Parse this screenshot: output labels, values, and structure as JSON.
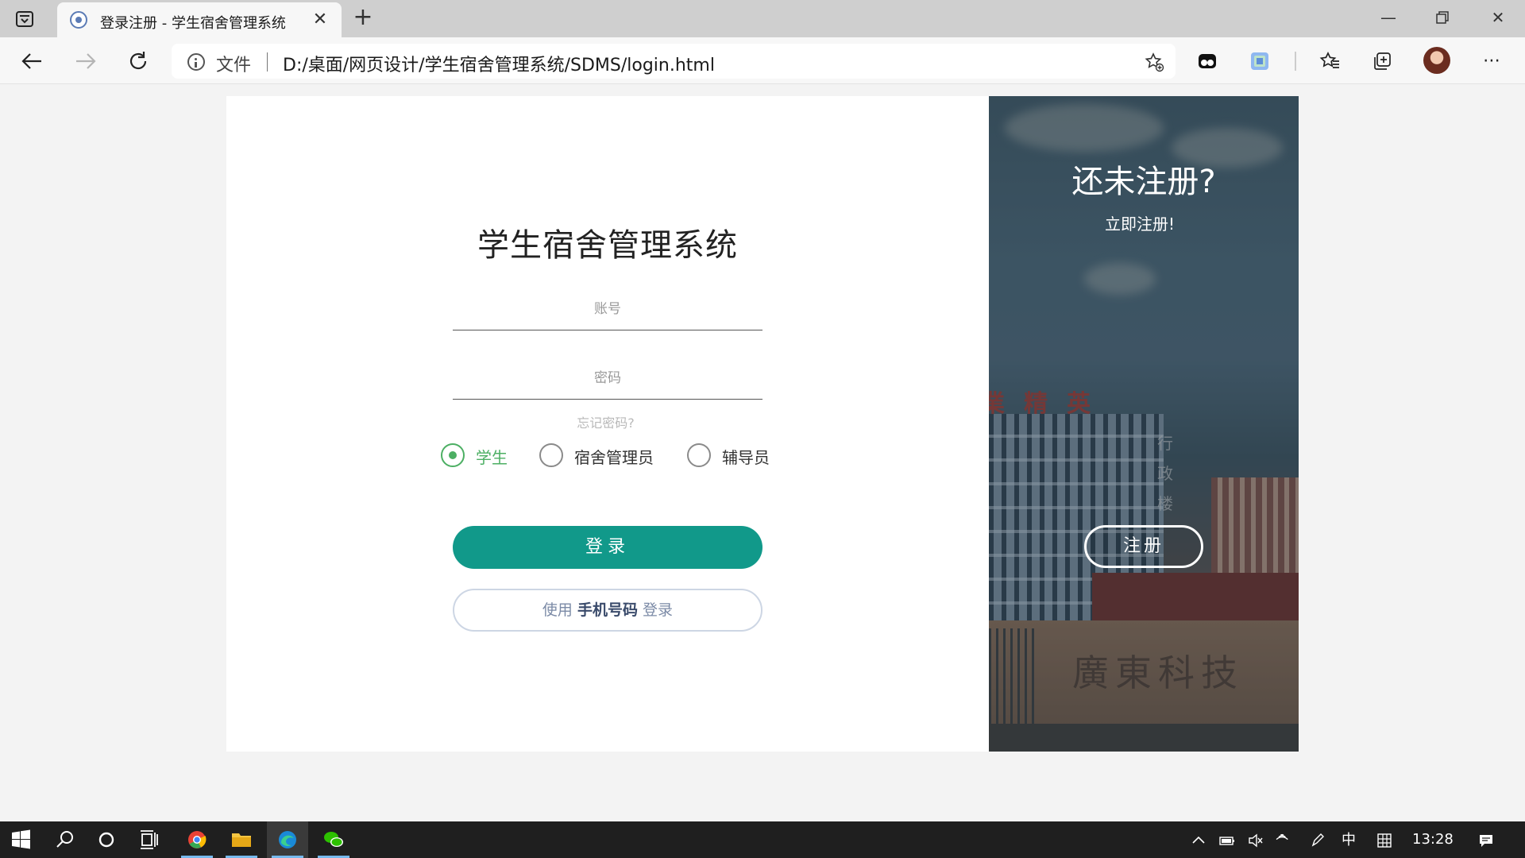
{
  "browser": {
    "tab_title": "登录注册 - 学生宿舍管理系统",
    "address_label": "文件",
    "address_url": "D:/桌面/网页设计/学生宿舍管理系统/SDMS/login.html"
  },
  "login": {
    "title": "学生宿舍管理系统",
    "account_placeholder": "账号",
    "password_placeholder": "密码",
    "forgot": "忘记密码?",
    "roles": [
      {
        "label": "学生",
        "checked": true
      },
      {
        "label": "宿舍管理员",
        "checked": false
      },
      {
        "label": "辅导员",
        "checked": false
      }
    ],
    "login_button": "登录",
    "phone_login_prefix": "使用",
    "phone_login_bold": "手机号码",
    "phone_login_suffix": "登录"
  },
  "register_panel": {
    "title": "还未注册?",
    "subtitle": "立即注册!",
    "button": "注册",
    "sign_text": "業精英",
    "vertical_text": "行政楼",
    "carved_text": "廣東科技"
  },
  "taskbar": {
    "ime": "中",
    "clock": "13:28"
  },
  "colors": {
    "primary": "#11998a",
    "radio_active": "#4caf63",
    "page_bg": "#f3f3f3"
  }
}
